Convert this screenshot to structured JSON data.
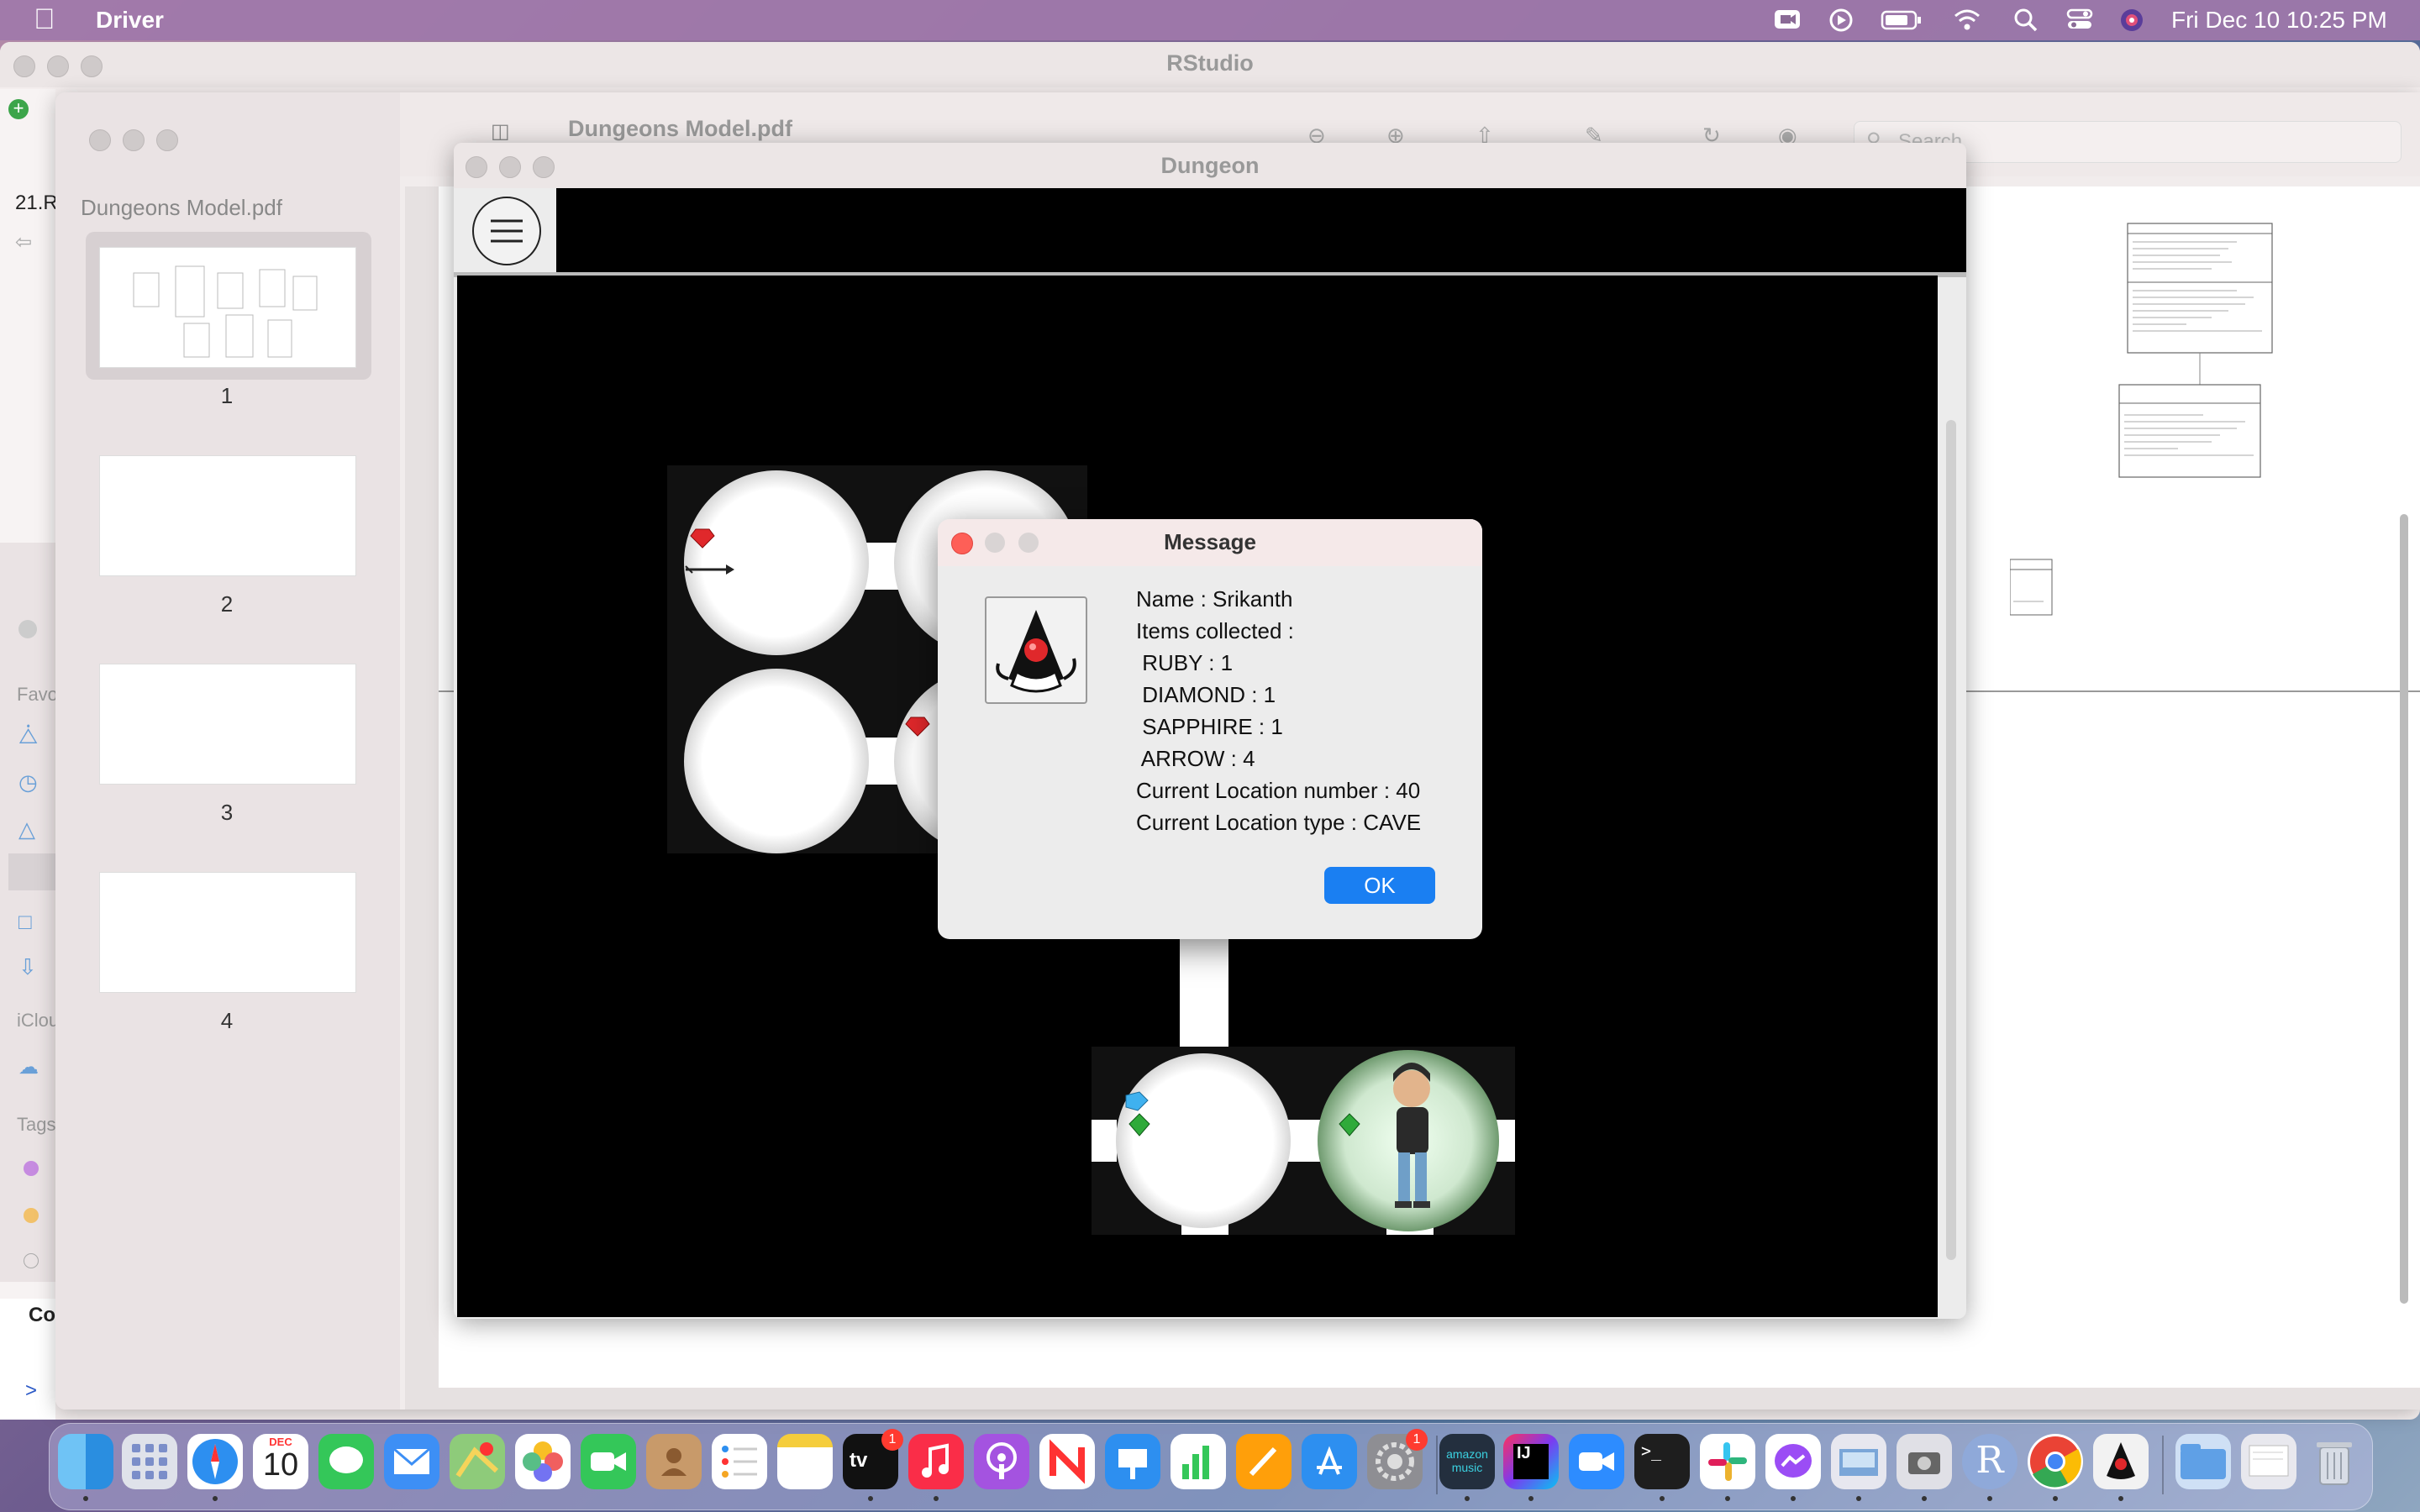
{
  "menubar": {
    "app_name": "Driver",
    "clock": "Fri Dec 10  10:25 PM"
  },
  "rstudio": {
    "title": "RStudio",
    "left_stub": "21.R",
    "sidebar_sections": [
      "Favo",
      "iClou",
      "Tags"
    ],
    "console_label": "Co",
    "prompt": ">"
  },
  "preview": {
    "sidebar_title": "Dungeons Model.pdf",
    "toolbar_title": "Dungeons Model.pdf",
    "search_placeholder": "Search",
    "pages": [
      "1",
      "2",
      "3",
      "4"
    ]
  },
  "dungeon": {
    "title": "Dungeon"
  },
  "message": {
    "title": "Message",
    "lines": [
      "Name : Srikanth",
      "Items collected :",
      " RUBY : 1",
      " DIAMOND : 1",
      " SAPPHIRE : 1",
      " ARROW : 4",
      "Current Location number : 40",
      "Current Location type : CAVE"
    ],
    "ok_label": "OK"
  },
  "dock": {
    "calendar_month": "DEC",
    "calendar_day": "10",
    "amazon_music_label": "amazon music",
    "tv_label": "tv",
    "badge_tv": "1",
    "badge_settings": "1",
    "r_label": "R",
    "ij_label": "IJ",
    "terminal_label": ">_"
  },
  "colors": {
    "ok_button": "#1a7ff2",
    "close_red": "#fe5f57",
    "ruby": "#e0282b",
    "diamond": "#2faa3a",
    "sapphire": "#3fb1ef"
  }
}
